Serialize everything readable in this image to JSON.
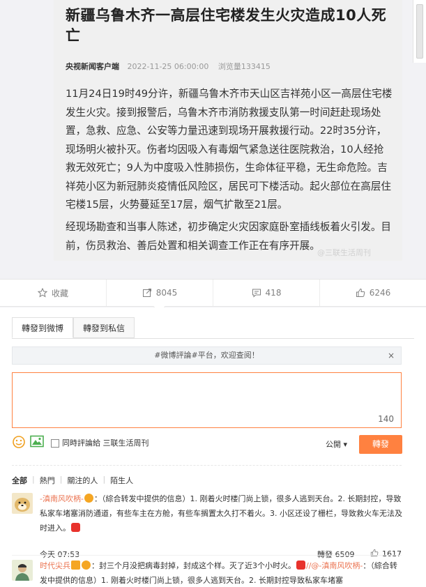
{
  "article": {
    "title": "新疆乌鲁木齐一高层住宅楼发生火灾造成10人死亡",
    "source": "央视新闻客户端",
    "date": "2022-11-25 06:00:00",
    "views": "浏览量133415",
    "paragraphs": [
      "11月24日19时49分许，新疆乌鲁木齐市天山区吉祥苑小区一高层住宅楼发生火灾。接到报警后，乌鲁木齐市消防救援支队第一时间赶赴现场处置，急救、应急、公安等力量迅速到现场开展救援行动。22时35分许，现场明火被扑灭。伤者均因吸入有毒烟气紧急送往医院救治，10人经抢救无效死亡；9人为中度吸入性肺损伤，生命体征平稳，无生命危险。吉祥苑小区为新冠肺炎疫情低风险区，居民可下楼活动。起火部位在高层住宅楼15层，火势蔓延至17层，烟气扩散至21层。",
      "经现场勘查和当事人陈述，初步确定火灾因家庭卧室插线板着火引发。目前，伤员救治、善后处置和相关调查工作正在有序开展。"
    ],
    "watermark": "@三联生活周刊"
  },
  "actions": {
    "favorite": "收藏",
    "repost": "8045",
    "comments": "418",
    "likes": "6246"
  },
  "repost_panel": {
    "tab_weibo": "轉發到微博",
    "tab_private": "轉發到私信",
    "notice": "#微博評論#平台，欢迎查阅！",
    "close": "×",
    "char_count": "140",
    "also_comment": "同時評論給 三联生活周刊",
    "visibility": "公開",
    "submit": "轉發"
  },
  "filters": [
    "全部",
    "熱門",
    "關注的人",
    "陌生人"
  ],
  "comments": [
    {
      "name": "-滇南风吹柄-",
      "text": "：（綜合转发中提供的信息）1. 刚着火时楼门尚上锁，很多人逃到天台。2. 长期封控，导致私家车堵塞消防通道，有些车主在方舱，有些车搁置太久打不着火。3. 小区还设了栅栏，导致救火车无法及时进入。",
      "time": "今天 07:53",
      "reposts": "轉發 6509",
      "likes": "1617"
    },
    {
      "name": "时代尖兵",
      "text": "：封三个月没把病毒封掉，封成这个样。灭了近3个小时火。",
      "mention": "//@-滇南风吹柄-",
      "text2": "：（綜合转发中提供的信息）1. 刚着火时楼门尚上锁，很多人逃到天台。2. 长期封控导致私家车堵塞"
    }
  ],
  "colors": {
    "accent": "#ff8140",
    "name": "#eb7350"
  }
}
